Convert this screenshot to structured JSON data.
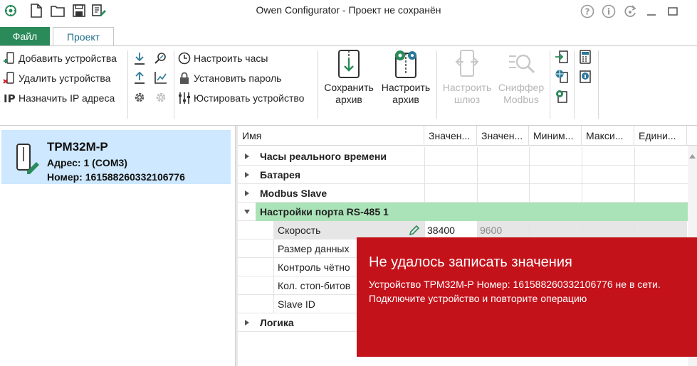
{
  "window": {
    "title": "Owen Configurator - Проект не сохранён",
    "quick_access_icons": [
      "logo-icon",
      "new-file-icon",
      "open-folder-icon",
      "save-icon",
      "edit-document-icon"
    ],
    "title_buttons": [
      "help-icon",
      "info-icon",
      "update-icon",
      "minimize-icon",
      "maximize-icon"
    ]
  },
  "tabs": [
    {
      "label": "Файл"
    },
    {
      "label": "Проект"
    }
  ],
  "ribbon": {
    "devices": {
      "add_label": "Добавить устройства",
      "remove_label": "Удалить устройства",
      "assign_ip_label": "Назначить IP адреса"
    },
    "actions": {
      "set_clock_label": "Настроить часы",
      "set_password_label": "Установить пароль",
      "calibrate_label": "Юстировать устройство"
    },
    "big_buttons": {
      "save_archive": {
        "line1": "Сохранить",
        "line2": "архив"
      },
      "configure_archive": {
        "line1": "Настроить",
        "line2": "архив"
      },
      "configure_gateway": {
        "line1": "Настроить",
        "line2": "шлюз",
        "disabled": true
      },
      "modbus_sniffer": {
        "line1": "Сниффер",
        "line2": "Modbus",
        "disabled": true
      }
    }
  },
  "device": {
    "name": "ТРМ32М-Р",
    "address": "Адрес: 1 (COM3)",
    "number": "Номер: 161588260332106776"
  },
  "grid": {
    "columns": [
      "Имя",
      "Значен...",
      "Значен...",
      "Миним...",
      "Макси...",
      "Едини..."
    ],
    "groups": [
      {
        "name": "Часы реального времени"
      },
      {
        "name": "Батарея"
      },
      {
        "name": "Modbus Slave"
      },
      {
        "name": "Настройки порта RS-485 1"
      },
      {
        "name": "Логика"
      }
    ],
    "params": [
      {
        "name": "Скорость",
        "value": "38400",
        "default": "9600"
      },
      {
        "name": "Размер данных"
      },
      {
        "name": "Контроль чётно"
      },
      {
        "name": "Кол. стоп-битов"
      },
      {
        "name": "Slave ID"
      }
    ]
  },
  "toast": {
    "title": "Не удалось записать значения",
    "line1": "Устройство ТРМ32М-Р Номер: 161588260332106776 не в сети.",
    "line2": "Подключите устройство и повторите операцию"
  },
  "colors": {
    "file_tab": "#2a8a5a",
    "selected_device": "#cde8ff",
    "active_group": "#abe3b8",
    "toast_background": "#c4121b",
    "edited_value": "#e6e6e6"
  }
}
